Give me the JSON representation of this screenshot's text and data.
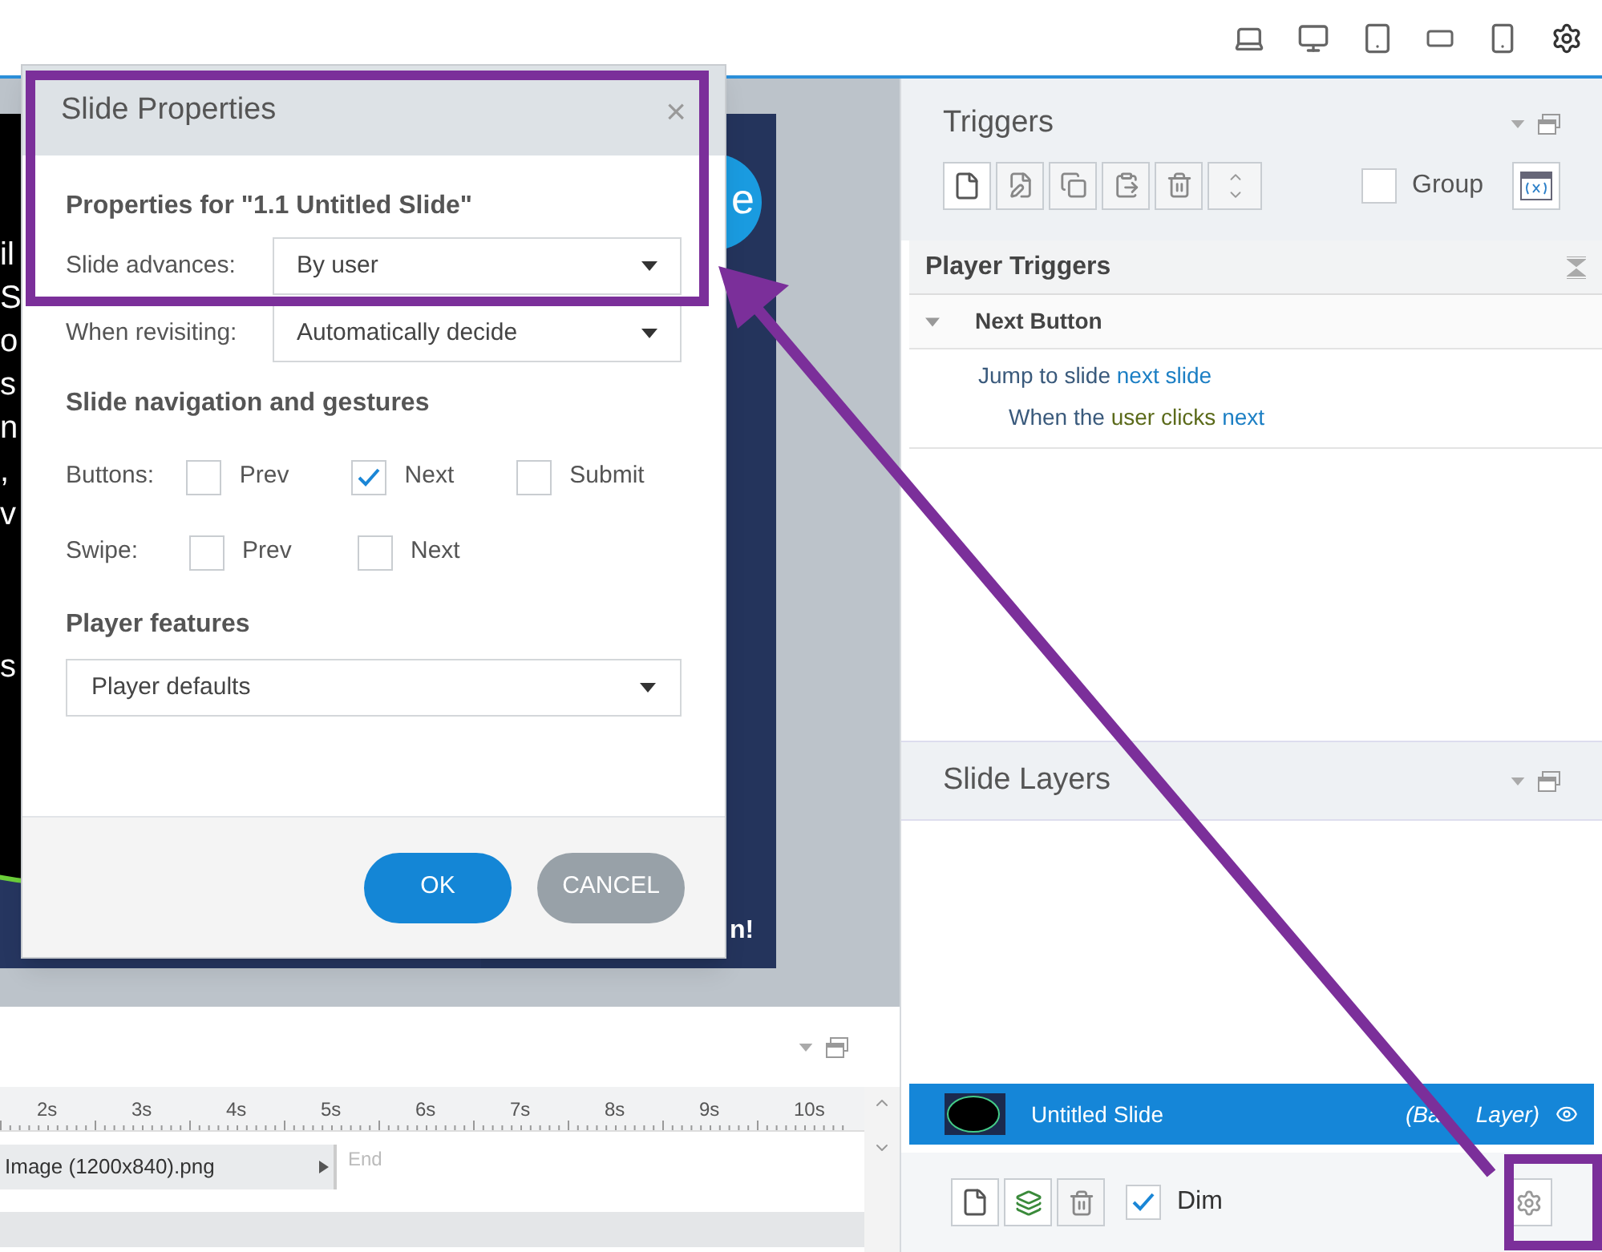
{
  "slide": {
    "fragments": [
      "il",
      "S",
      "o",
      "s",
      "n",
      ",",
      "v",
      "s"
    ],
    "button_letter": "e",
    "footer_text": "n!"
  },
  "dialog": {
    "title": "Slide Properties",
    "close": "×",
    "heading": "Properties for \"1.1 Untitled Slide\"",
    "fields": [
      {
        "label": "Slide advances:",
        "value": "By user"
      },
      {
        "label": "When revisiting:",
        "value": "Automatically decide"
      }
    ],
    "nav_heading": "Slide navigation and gestures",
    "nav_rows": [
      {
        "label": "Buttons:",
        "options": [
          {
            "label": "Prev",
            "checked": false
          },
          {
            "label": "Next",
            "checked": true
          },
          {
            "label": "Submit",
            "checked": false
          }
        ]
      },
      {
        "label": "Swipe:",
        "options": [
          {
            "label": "Prev",
            "checked": false
          },
          {
            "label": "Next",
            "checked": false
          }
        ]
      }
    ],
    "player_heading": "Player features",
    "player_value": "Player defaults",
    "buttons": [
      {
        "label": "OK",
        "kind": "primary"
      },
      {
        "label": "CANCEL",
        "kind": "secondary"
      }
    ]
  },
  "timeline": {
    "ticks": [
      "2s",
      "3s",
      "4s",
      "5s",
      "6s",
      "7s",
      "8s",
      "9s",
      "10s"
    ],
    "row_label": "Image (1200x840).png",
    "end_label": "End"
  },
  "triggers": {
    "title": "Triggers",
    "group": {
      "label": "Group",
      "checked": false
    },
    "section": "Player Triggers",
    "trigger": {
      "name": "Next Button",
      "expanded": true,
      "action": "Jump to slide",
      "target": "next slide",
      "when": "When the",
      "event": "user clicks",
      "object": "next"
    }
  },
  "layers": {
    "title": "Slide Layers",
    "items": [
      {
        "name": "Untitled Slide",
        "note_start": "(Ba",
        "note_end": "Layer)",
        "selected": true,
        "visible": true
      }
    ],
    "dim": {
      "label": "Dim",
      "checked": true
    }
  }
}
